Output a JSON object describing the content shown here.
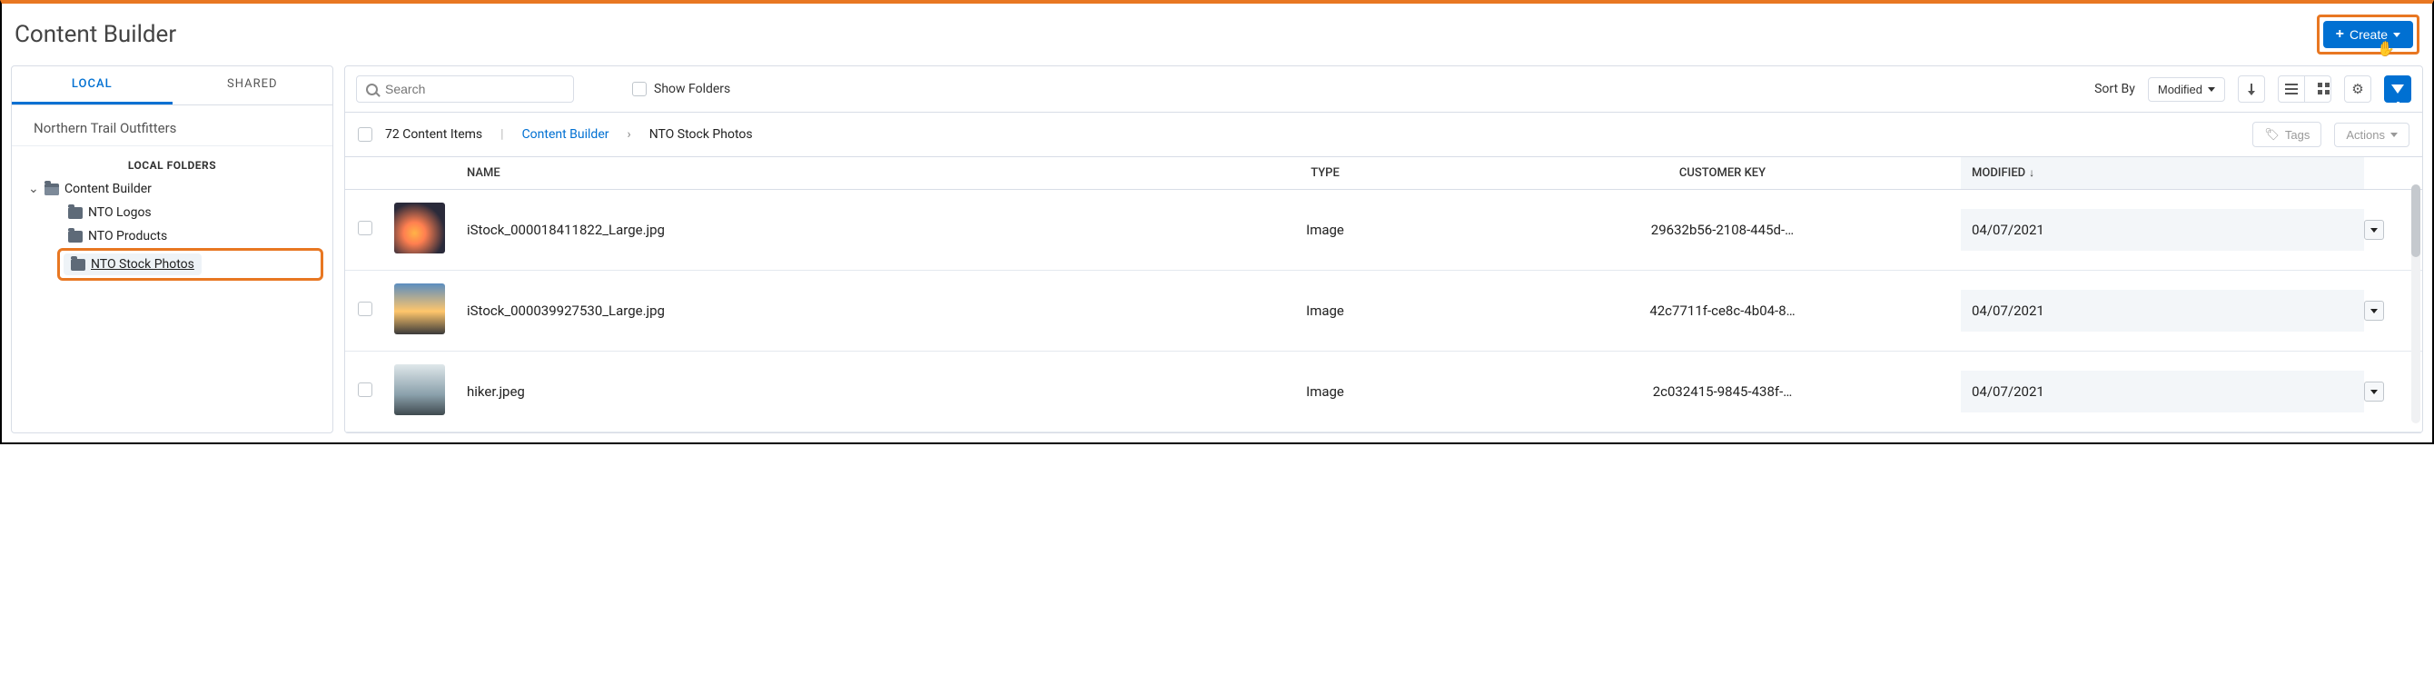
{
  "title": "Content Builder",
  "create_label": "Create",
  "sidebar": {
    "tabs": {
      "local": "LOCAL",
      "shared": "SHARED"
    },
    "org_name": "Northern Trail Outfitters",
    "folders_header": "LOCAL FOLDERS",
    "root": "Content Builder",
    "children": [
      {
        "label": "NTO Logos"
      },
      {
        "label": "NTO Products"
      },
      {
        "label": "NTO Stock Photos",
        "selected": true
      }
    ]
  },
  "toolbar": {
    "search_placeholder": "Search",
    "show_folders": "Show Folders",
    "sort_by_label": "Sort By",
    "sort_value": "Modified"
  },
  "info": {
    "count_label": "72 Content Items",
    "breadcrumb_root": "Content Builder",
    "breadcrumb_current": "NTO Stock Photos",
    "tags_label": "Tags",
    "actions_label": "Actions"
  },
  "columns": {
    "name": "NAME",
    "type": "TYPE",
    "key": "CUSTOMER KEY",
    "modified": "MODIFIED"
  },
  "rows": [
    {
      "name": "iStock_000018411822_Large.jpg",
      "type": "Image",
      "key": "29632b56-2108-445d-…",
      "modified": "04/07/2021"
    },
    {
      "name": "iStock_000039927530_Large.jpg",
      "type": "Image",
      "key": "42c7711f-ce8c-4b04-8…",
      "modified": "04/07/2021"
    },
    {
      "name": "hiker.jpeg",
      "type": "Image",
      "key": "2c032415-9845-438f-…",
      "modified": "04/07/2021"
    }
  ]
}
